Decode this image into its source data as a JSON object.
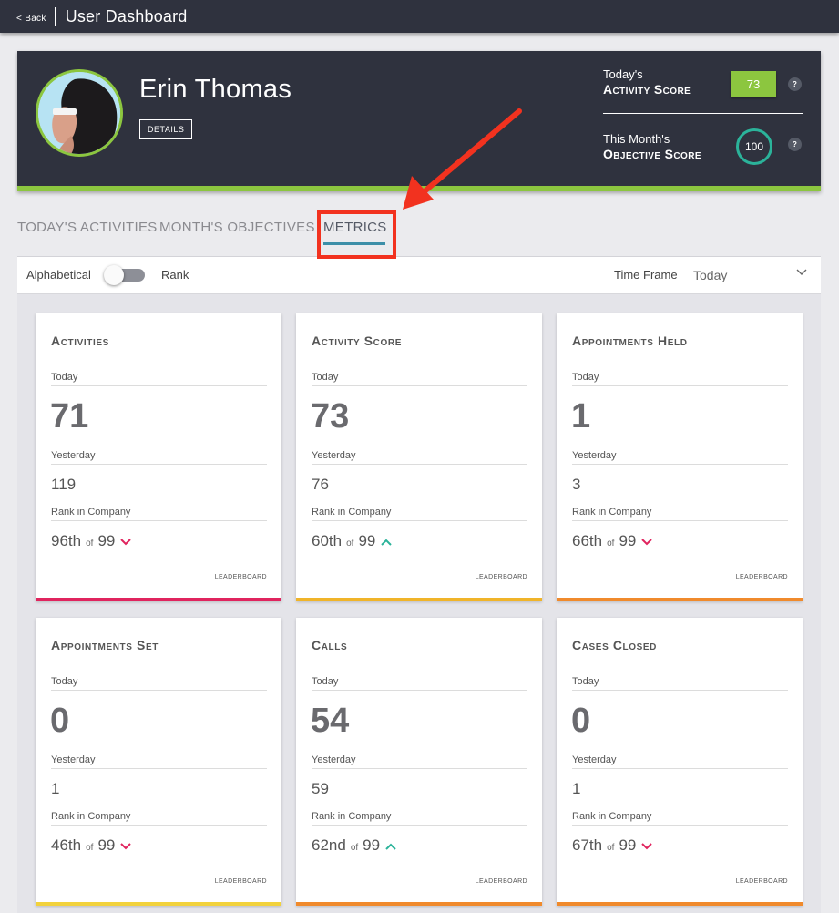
{
  "topbar": {
    "back_label": "< Back",
    "title": "User Dashboard"
  },
  "user": {
    "name": "Erin Thomas",
    "details_label": "Details"
  },
  "scores": {
    "activity": {
      "line1": "Today's",
      "line2": "Activity Score",
      "value": "73"
    },
    "objective": {
      "line1": "This Month's",
      "line2": "Objective Score",
      "value": "100"
    },
    "help_glyph": "?"
  },
  "tabs": [
    {
      "label": "TODAY'S ACTIVITIES"
    },
    {
      "label": "MONTH'S OBJECTIVES"
    },
    {
      "label": "METRICS",
      "active": true
    }
  ],
  "controls": {
    "sort_left": "Alphabetical",
    "sort_right": "Rank",
    "toggle_on": false,
    "timeframe_label": "Time Frame",
    "timeframe_value": "Today"
  },
  "colors": {
    "topbar": "#2f323e",
    "accent_green": "#8cc63f",
    "teal": "#2bb39a",
    "tab_underline": "#3d8fa8",
    "annotation_red": "#f2321f",
    "trend_down": "#e0245e",
    "trend_up": "#2bb39a"
  },
  "labels": {
    "today": "Today",
    "yesterday": "Yesterday",
    "rank": "Rank in Company",
    "of": "of",
    "leaderboard": "Leaderboard"
  },
  "metrics": [
    {
      "title": "Activities",
      "today": "71",
      "yesterday": "119",
      "rank": "96th",
      "total": "99",
      "trend": "down",
      "bar_color": "#e0245e"
    },
    {
      "title": "Activity Score",
      "today": "73",
      "yesterday": "76",
      "rank": "60th",
      "total": "99",
      "trend": "up",
      "bar_color": "#f0b429"
    },
    {
      "title": "Appointments Held",
      "today": "1",
      "yesterday": "3",
      "rank": "66th",
      "total": "99",
      "trend": "down",
      "bar_color": "#f08a2c"
    },
    {
      "title": "Appointments Set",
      "today": "0",
      "yesterday": "1",
      "rank": "46th",
      "total": "99",
      "trend": "down",
      "bar_color": "#f2d23c"
    },
    {
      "title": "Calls",
      "today": "54",
      "yesterday": "59",
      "rank": "62nd",
      "total": "99",
      "trend": "up",
      "bar_color": "#f08a2c"
    },
    {
      "title": "Cases Closed",
      "today": "0",
      "yesterday": "1",
      "rank": "67th",
      "total": "99",
      "trend": "down",
      "bar_color": "#f08a2c"
    }
  ]
}
